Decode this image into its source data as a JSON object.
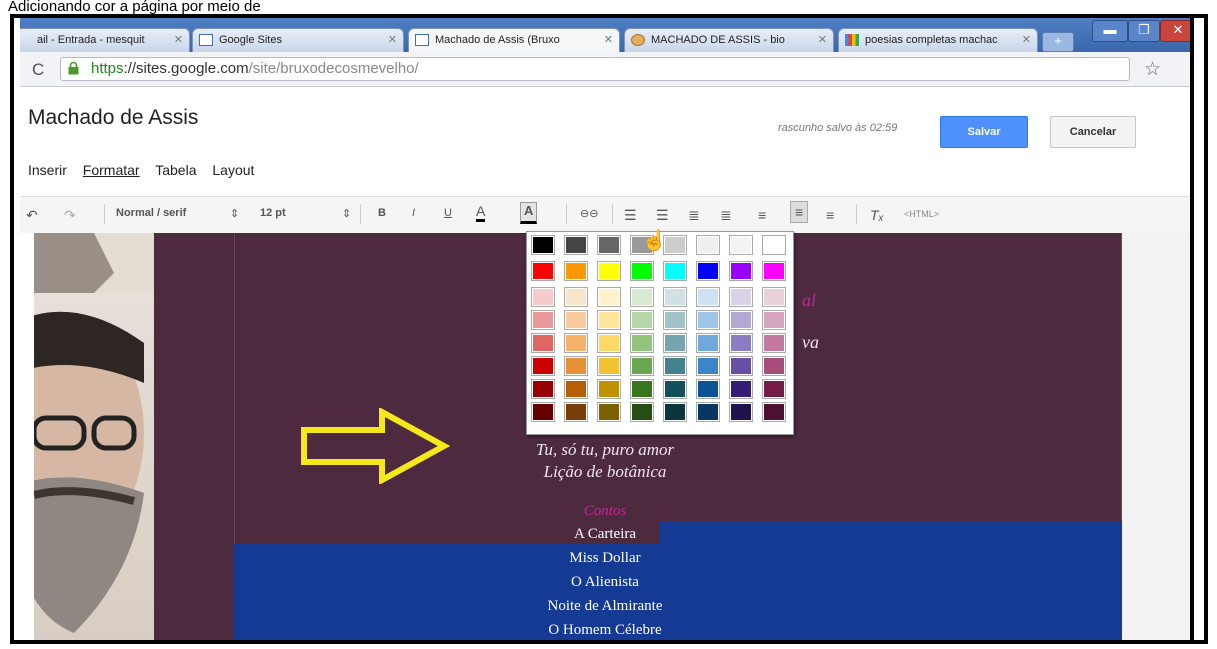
{
  "caption": "Adicionando cor a página por meio de",
  "browser": {
    "tabs": [
      {
        "label": "ail - Entrada - mesquit",
        "active": false
      },
      {
        "label": "Google Sites",
        "active": false
      },
      {
        "label": "Machado de Assis (Bruxo",
        "active": true
      },
      {
        "label": "MACHADO DE ASSIS - bio",
        "active": false
      },
      {
        "label": "poesias completas machac",
        "active": false
      }
    ],
    "url_scheme": "https",
    "url_host": "://sites.google.com",
    "url_path": "/site/bruxodecosmevelho/"
  },
  "site": {
    "title": "Machado de Assis",
    "draft_note": "rascunho salvo às 02:59",
    "save_label": "Salvar",
    "cancel_label": "Cancelar",
    "menu": [
      "Inserir",
      "Formatar",
      "Tabela",
      "Layout"
    ]
  },
  "toolbar": {
    "style": "Normal / serif",
    "size": "12 pt",
    "html_label": "<HTML>"
  },
  "content": {
    "fragment_1": "al",
    "fragment_2": "va",
    "poems": [
      "Tu, só tu, puro amor",
      "Lição de botânica"
    ],
    "contos_title": "Contos",
    "stories": [
      "A Carteira",
      "Miss Dollar",
      "O Alienista",
      "Noite de Almirante",
      "O Homem Célebre"
    ]
  },
  "palette": {
    "gray_row": [
      "#000000",
      "#444444",
      "#666666",
      "#999999",
      "#cccccc",
      "#eeeeee",
      "#f3f3f3",
      "#ffffff"
    ],
    "bright_row": [
      "#ff0000",
      "#ff9900",
      "#ffff00",
      "#00ff00",
      "#00ffff",
      "#0000ff",
      "#9900ff",
      "#ff00ff"
    ],
    "shades": [
      [
        "#f4cccc",
        "#fce5cd",
        "#fff2cc",
        "#d9ead3",
        "#d0e0e3",
        "#cfe2f3",
        "#d9d2e9",
        "#ead1dc"
      ],
      [
        "#ea9999",
        "#f9cb9c",
        "#ffe599",
        "#b6d7a8",
        "#a2c4c9",
        "#9fc5e8",
        "#b4a7d6",
        "#d5a6bd"
      ],
      [
        "#e06666",
        "#f6b26b",
        "#ffd966",
        "#93c47d",
        "#76a5af",
        "#6fa8dc",
        "#8e7cc3",
        "#c27ba0"
      ],
      [
        "#cc0000",
        "#e69138",
        "#f1c232",
        "#6aa84f",
        "#45818e",
        "#3d85c6",
        "#674ea7",
        "#a64d79"
      ],
      [
        "#990000",
        "#b45f06",
        "#bf9000",
        "#38761d",
        "#134f5c",
        "#0b5394",
        "#351c75",
        "#741b47"
      ],
      [
        "#660000",
        "#783f04",
        "#7f6000",
        "#274e13",
        "#0c343d",
        "#073763",
        "#20124d",
        "#4c1130"
      ]
    ]
  },
  "colors": {
    "page_bg": "#4e2a3e",
    "blue_panel": "#143a93",
    "arrow": "#f5e81b"
  }
}
